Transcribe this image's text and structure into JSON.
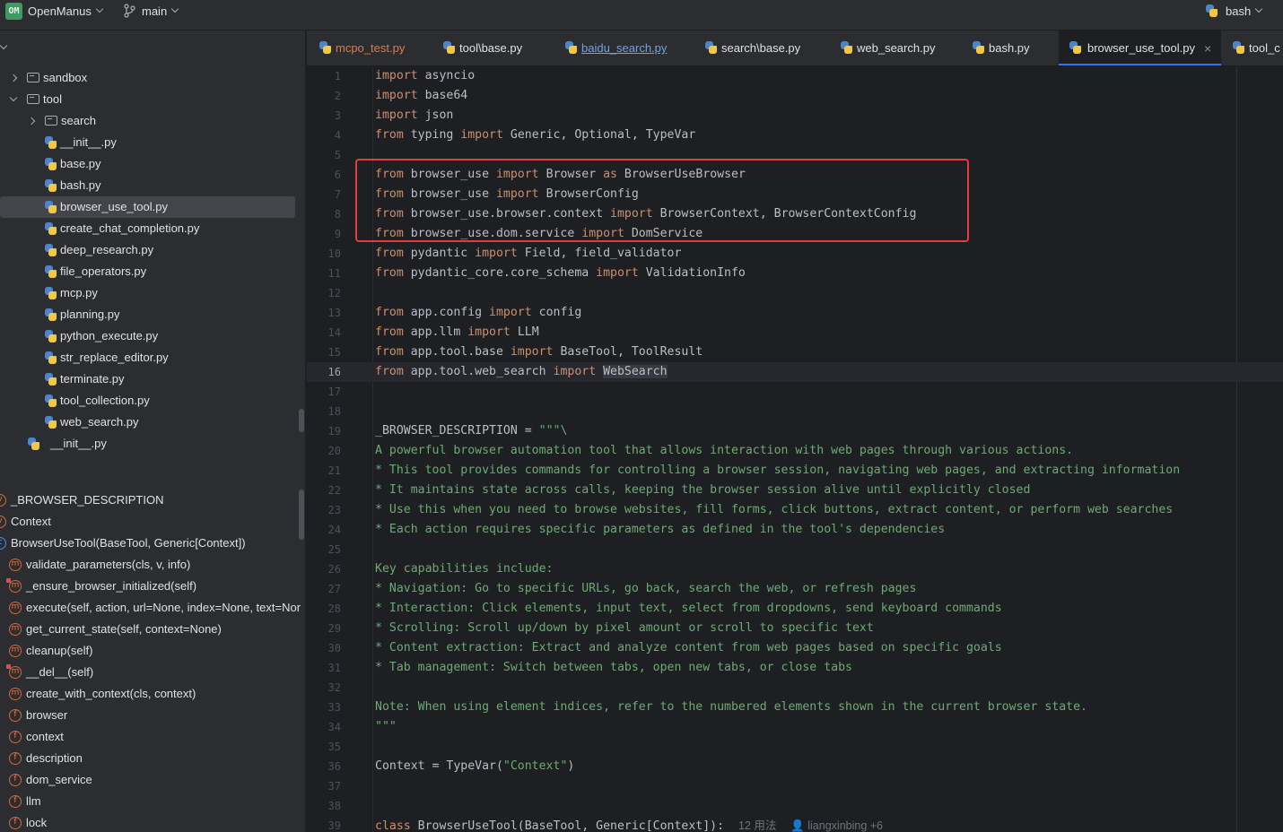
{
  "topbar": {
    "project_badge": "OM",
    "project_name": "OpenManus",
    "branch": "main",
    "run_config": "bash"
  },
  "project_tree": [
    {
      "label": "sandbox",
      "type": "folder",
      "expanded": false
    },
    {
      "label": "tool",
      "type": "folder",
      "expanded": true
    },
    {
      "label": "search",
      "type": "folder",
      "expanded": false
    },
    {
      "label": "__init__.py",
      "type": "py"
    },
    {
      "label": "base.py",
      "type": "py"
    },
    {
      "label": "bash.py",
      "type": "py"
    },
    {
      "label": "browser_use_tool.py",
      "type": "py",
      "selected": true
    },
    {
      "label": "create_chat_completion.py",
      "type": "py"
    },
    {
      "label": "deep_research.py",
      "type": "py"
    },
    {
      "label": "file_operators.py",
      "type": "py"
    },
    {
      "label": "mcp.py",
      "type": "py"
    },
    {
      "label": "planning.py",
      "type": "py"
    },
    {
      "label": "python_execute.py",
      "type": "py"
    },
    {
      "label": "str_replace_editor.py",
      "type": "py"
    },
    {
      "label": "terminate.py",
      "type": "py"
    },
    {
      "label": "tool_collection.py",
      "type": "py"
    },
    {
      "label": "web_search.py",
      "type": "py"
    },
    {
      "label": "__init__.py",
      "type": "py"
    }
  ],
  "structure": [
    {
      "label": "_BROWSER_DESCRIPTION",
      "icon": "v"
    },
    {
      "label": "Context",
      "icon": "v"
    },
    {
      "label": "BrowserUseTool(BaseTool, Generic[Context])",
      "icon": "c"
    },
    {
      "label": "validate_parameters(cls, v, info)",
      "icon": "m"
    },
    {
      "label": "_ensure_browser_initialized(self)",
      "icon": "m",
      "private": true
    },
    {
      "label": "execute(self, action, url=None, index=None, text=Nor",
      "icon": "m"
    },
    {
      "label": "get_current_state(self, context=None)",
      "icon": "m"
    },
    {
      "label": "cleanup(self)",
      "icon": "m"
    },
    {
      "label": "__del__(self)",
      "icon": "m",
      "private": true
    },
    {
      "label": "create_with_context(cls, context)",
      "icon": "m"
    },
    {
      "label": "browser",
      "icon": "f"
    },
    {
      "label": "context",
      "icon": "f"
    },
    {
      "label": "description",
      "icon": "f"
    },
    {
      "label": "dom_service",
      "icon": "f"
    },
    {
      "label": "llm",
      "icon": "f"
    },
    {
      "label": "lock",
      "icon": "f"
    }
  ],
  "tabs": [
    {
      "label": "mcpo_test.py",
      "style": "modified"
    },
    {
      "label": "tool\\base.py",
      "style": "normal"
    },
    {
      "label": "baidu_search.py",
      "style": "link"
    },
    {
      "label": "search\\base.py",
      "style": "normal"
    },
    {
      "label": "web_search.py",
      "style": "normal"
    },
    {
      "label": "bash.py",
      "style": "normal"
    },
    {
      "label": "browser_use_tool.py",
      "style": "active"
    },
    {
      "label": "tool_c",
      "style": "normal"
    }
  ],
  "editor": {
    "current_line": 16,
    "lines": [
      {
        "n": "1",
        "code": "import asyncio"
      },
      {
        "n": "2",
        "code": "import base64"
      },
      {
        "n": "3",
        "code": "import json"
      },
      {
        "n": "4",
        "code": "from typing import Generic, Optional, TypeVar"
      },
      {
        "n": "5",
        "code": ""
      },
      {
        "n": "6",
        "code": "from browser_use import Browser as BrowserUseBrowser"
      },
      {
        "n": "7",
        "code": "from browser_use import BrowserConfig"
      },
      {
        "n": "8",
        "code": "from browser_use.browser.context import BrowserContext, BrowserContextConfig"
      },
      {
        "n": "9",
        "code": "from browser_use.dom.service import DomService"
      },
      {
        "n": "10",
        "code": "from pydantic import Field, field_validator"
      },
      {
        "n": "11",
        "code": "from pydantic_core.core_schema import ValidationInfo"
      },
      {
        "n": "12",
        "code": ""
      },
      {
        "n": "13",
        "code": "from app.config import config"
      },
      {
        "n": "14",
        "code": "from app.llm import LLM"
      },
      {
        "n": "15",
        "code": "from app.tool.base import BaseTool, ToolResult"
      },
      {
        "n": "16",
        "code": "from app.tool.web_search import WebSearch"
      },
      {
        "n": "17",
        "code": ""
      },
      {
        "n": "18",
        "code": ""
      },
      {
        "n": "19",
        "code": "_BROWSER_DESCRIPTION = \"\"\"\\"
      },
      {
        "n": "20",
        "code": "A powerful browser automation tool that allows interaction with web pages through various actions."
      },
      {
        "n": "21",
        "code": "* This tool provides commands for controlling a browser session, navigating web pages, and extracting information"
      },
      {
        "n": "22",
        "code": "* It maintains state across calls, keeping the browser session alive until explicitly closed"
      },
      {
        "n": "23",
        "code": "* Use this when you need to browse websites, fill forms, click buttons, extract content, or perform web searches"
      },
      {
        "n": "24",
        "code": "* Each action requires specific parameters as defined in the tool's dependencies"
      },
      {
        "n": "25",
        "code": ""
      },
      {
        "n": "26",
        "code": "Key capabilities include:"
      },
      {
        "n": "27",
        "code": "* Navigation: Go to specific URLs, go back, search the web, or refresh pages"
      },
      {
        "n": "28",
        "code": "* Interaction: Click elements, input text, select from dropdowns, send keyboard commands"
      },
      {
        "n": "29",
        "code": "* Scrolling: Scroll up/down by pixel amount or scroll to specific text"
      },
      {
        "n": "30",
        "code": "* Content extraction: Extract and analyze content from web pages based on specific goals"
      },
      {
        "n": "31",
        "code": "* Tab management: Switch between tabs, open new tabs, or close tabs"
      },
      {
        "n": "32",
        "code": ""
      },
      {
        "n": "33",
        "code": "Note: When using element indices, refer to the numbered elements shown in the current browser state."
      },
      {
        "n": "34",
        "code": "\"\"\""
      },
      {
        "n": "35",
        "code": ""
      },
      {
        "n": "36",
        "code": "Context = TypeVar(\"Context\")"
      },
      {
        "n": "37",
        "code": ""
      },
      {
        "n": "38",
        "code": ""
      },
      {
        "n": "39",
        "code": "class BrowserUseTool(BaseTool, Generic[Context]):"
      }
    ],
    "inlay_usages": "12 用法",
    "inlay_author": "liangxinbing +6"
  }
}
